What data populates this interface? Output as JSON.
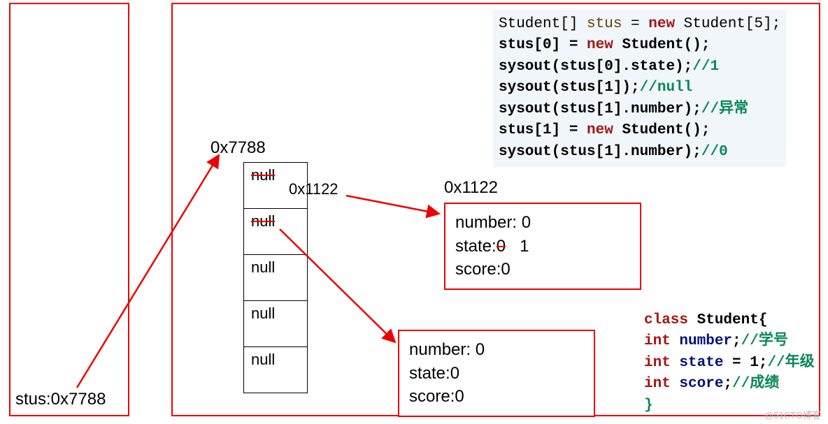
{
  "stack": {
    "label": "stus:0x7788"
  },
  "heap": {
    "array_addr": "0x7788",
    "array_cells": [
      "null",
      "null",
      "null",
      "null",
      "null"
    ],
    "struck": [
      true,
      true,
      false,
      false,
      false
    ],
    "ref_addr": "0x1122",
    "obj1": {
      "addr": "0x1122",
      "lines": [
        "number: 0",
        "state:0   1",
        "score:0"
      ],
      "state_struck": true
    },
    "obj2": {
      "lines": [
        "number: 0",
        "state:0",
        "score:0"
      ]
    }
  },
  "code_top": {
    "line1": "Student[] stus = new Student[5];",
    "line2": "stus[0] = new Student();",
    "line3": "sysout(stus[0].state);//1",
    "line4": "sysout(stus[1]);//null",
    "line5": "sysout(stus[1].number);//异常",
    "line6": "stus[1] = new Student();",
    "line7": "sysout(stus[1].number);//0"
  },
  "code_bottom": {
    "line1": "class Student{",
    "line2": "int number;//学号",
    "line3": "int state = 1;//年级",
    "line4": "int score;//成绩",
    "line5": "}"
  },
  "watermark": "@51CTO博客"
}
